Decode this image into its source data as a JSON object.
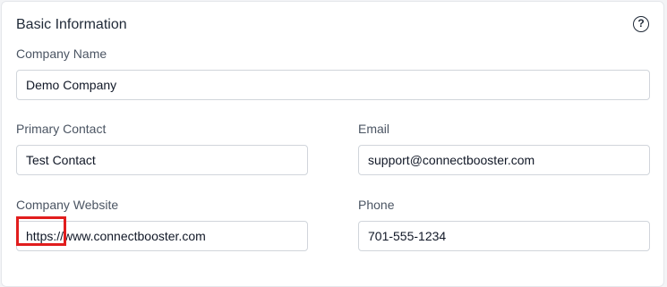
{
  "section": {
    "title": "Basic Information",
    "help_icon": "question-circle-icon",
    "help_glyph": "?"
  },
  "fields": {
    "company_name": {
      "label": "Company Name",
      "value": "Demo Company"
    },
    "primary_contact": {
      "label": "Primary Contact",
      "value": "Test Contact"
    },
    "email": {
      "label": "Email",
      "value": "support@connectbooster.com"
    },
    "company_website": {
      "label": "Company Website",
      "value": "https://www.connectbooster.com"
    },
    "phone": {
      "label": "Phone",
      "value": "701-555-1234"
    }
  },
  "highlight": {
    "color": "#e11d1d",
    "target": "https://"
  },
  "colors": {
    "label": "#4b5563",
    "text": "#111827",
    "border": "#d1d5db",
    "background": "#f3f4f6"
  }
}
